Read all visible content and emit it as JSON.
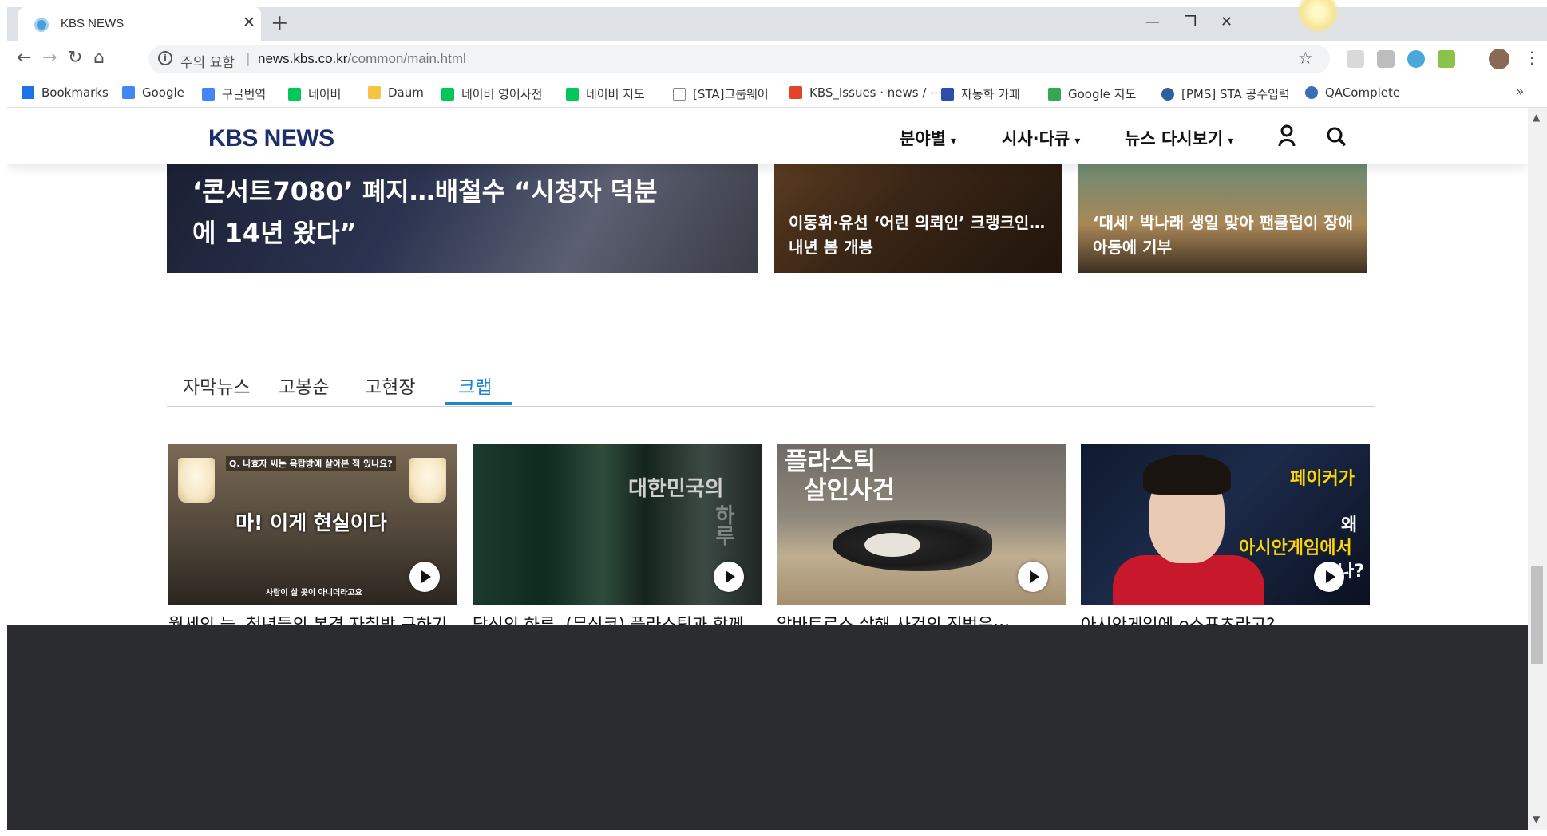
{
  "browser": {
    "tab_title": "KBS NEWS",
    "tab_close": "✕",
    "new_tab": "+",
    "address_warning": "주의 요함",
    "address_sep": "|",
    "address_host": "news.kbs.co.kr",
    "address_path": "/common/main.html",
    "bookmarks": [
      {
        "label": "Bookmarks",
        "color": "#1a73e8"
      },
      {
        "label": "Google",
        "color": "#4285f4"
      },
      {
        "label": "구글번역",
        "color": "#4285f4"
      },
      {
        "label": "네이버",
        "color": "#03c75a"
      },
      {
        "label": "Daum",
        "color": "#f6c343"
      },
      {
        "label": "네이버 영어사전",
        "color": "#03c75a"
      },
      {
        "label": "네이버 지도",
        "color": "#03c75a"
      },
      {
        "label": "[STA]그룹웨어",
        "color": "#888888"
      },
      {
        "label": "KBS_Issues · news / ⋯",
        "color": "#e24329"
      },
      {
        "label": "자동화 카페",
        "color": "#2a4fa8"
      },
      {
        "label": "Google 지도",
        "color": "#34a853"
      },
      {
        "label": "[PMS] STA 공수입력",
        "color": "#2f5fa0"
      },
      {
        "label": "QAComplete",
        "color": "#3b6fb5"
      }
    ],
    "bookmarks_more": "»"
  },
  "site": {
    "logo": "KBS NEWS",
    "nav": [
      {
        "label": "분야별"
      },
      {
        "label": "시사·다큐"
      },
      {
        "label": "뉴스 다시보기"
      }
    ],
    "caret": "▾"
  },
  "hero": {
    "main_title": "‘콘서트7080’ 폐지…배철수 “시청자 덕분에 14년 왔다”",
    "sub1_title": "이동휘·유선 ‘어린 의뢰인’ 크랭크인…내년 봄 개봉",
    "sub2_title": "‘대세’ 박나래 생일 맞아 팬클럽이 장애아동에 기부"
  },
  "video_tabs": [
    {
      "label": "자막뉴스",
      "active": false
    },
    {
      "label": "고봉순",
      "active": false
    },
    {
      "label": "고현장",
      "active": false
    },
    {
      "label": "크랩",
      "active": true
    }
  ],
  "videos": [
    {
      "title": "월세의 늪, 청년들의 본격 자취방 구하기",
      "thumb_caption_top": "Q. 나효자 씨는 옥탑방에 살아본 적 있나요?",
      "thumb_caption_main": "마! 이게 현실이다",
      "thumb_caption_bottom": "사람이 살 곳이 아니더라고요"
    },
    {
      "title": "당신의 하루, (무심코) 플라스틱과 함께 하셨나요?",
      "thumb_caption_main": "대한민국의",
      "thumb_caption_vertical": "하루"
    },
    {
      "title": "알바트로스 살해 사건의 진범은⋯",
      "thumb_caption_line1": "플라스틱",
      "thumb_caption_line2": "살인사건"
    },
    {
      "title": "아시안게임에 e스포츠라고?",
      "thumb_caption_line1": "페이커가",
      "thumb_caption_line2": "왜",
      "thumb_caption_line3": "아시안게임에서",
      "thumb_caption_line4": "나?"
    }
  ],
  "colors": {
    "logo": "#1e2e6b",
    "active_tab": "#1a87d0",
    "footer": "#2a2c30"
  }
}
